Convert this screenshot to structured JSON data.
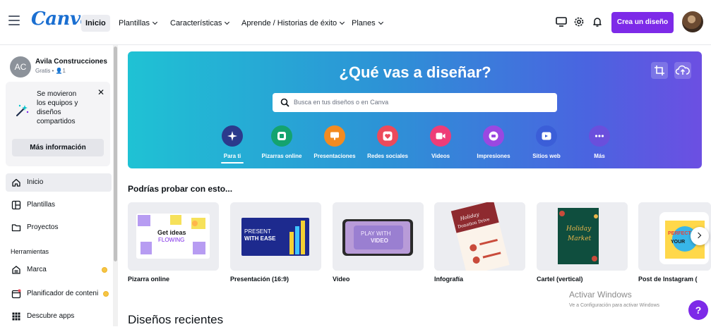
{
  "header": {
    "logo": "Canva",
    "nav": [
      {
        "label": "Inicio"
      },
      {
        "label": "Plantillas"
      },
      {
        "label": "Características"
      },
      {
        "label": "Aprende / Historias de éxito"
      },
      {
        "label": "Planes"
      }
    ],
    "icons": [
      "desktop-icon",
      "gear-icon",
      "bell-icon"
    ],
    "create_button": "Crea un diseño"
  },
  "sidebar": {
    "account": {
      "initials": "AC",
      "name": "Avila Construcciones",
      "meta": "Gratis • 👤1"
    },
    "notice": {
      "text": "Se movieron los equipos y diseños compartidos",
      "button": "Más información"
    },
    "items": [
      {
        "label": "Inicio",
        "icon": "home-icon"
      },
      {
        "label": "Plantillas",
        "icon": "template-icon"
      },
      {
        "label": "Proyectos",
        "icon": "folder-icon"
      }
    ],
    "section_label": "Herramientas",
    "tools": [
      {
        "label": "Marca",
        "icon": "brand-icon"
      },
      {
        "label": "Planificador de conteni",
        "icon": "calendar-icon"
      },
      {
        "label": "Descubre apps",
        "icon": "apps-icon"
      }
    ]
  },
  "hero": {
    "title": "¿Qué vas a diseñar?",
    "search_placeholder": "Busca en tus diseños o en Canva",
    "categories": [
      {
        "label": "Para ti",
        "icon": "sparkle-icon",
        "color": "#2b3a8c"
      },
      {
        "label": "Pizarras online",
        "icon": "whiteboard-icon",
        "color": "#14a36f"
      },
      {
        "label": "Presentaciones",
        "icon": "presentation-icon",
        "color": "#f28b21"
      },
      {
        "label": "Redes sociales",
        "icon": "heart-icon",
        "color": "#ec4a5b"
      },
      {
        "label": "Videos",
        "icon": "video-icon",
        "color": "#ee3d78"
      },
      {
        "label": "Impresiones",
        "icon": "print-icon",
        "color": "#9a48e1"
      },
      {
        "label": "Sitios web",
        "icon": "website-icon",
        "color": "#3b5ed8"
      },
      {
        "label": "Más",
        "icon": "more-icon",
        "color": "#6a4fdc"
      }
    ]
  },
  "suggestions": {
    "title": "Podrías probar con esto...",
    "cards": [
      {
        "label": "Pizarra online",
        "thumb_text": "Get ideas",
        "thumb_text2": "FLOWING"
      },
      {
        "label": "Presentación (16:9)",
        "thumb_text": "PRESENT",
        "thumb_text2": "WITH EASE"
      },
      {
        "label": "Video",
        "thumb_text": "PLAY WITH",
        "thumb_text2": "VIDEO"
      },
      {
        "label": "Infografía",
        "thumb_text": "Holiday",
        "thumb_text2": "Donation Drive"
      },
      {
        "label": "Cartel (vertical)",
        "thumb_text": "Holiday",
        "thumb_text2": "Market"
      },
      {
        "label": "Post de Instagram (",
        "thumb_text": "PERFECT",
        "thumb_text2": "YOUR"
      }
    ]
  },
  "recent": {
    "title": "Diseños recientes"
  },
  "windows_watermark": {
    "title": "Activar Windows",
    "subtitle": "Ve a Configuración para activar Windows"
  },
  "help": "?"
}
